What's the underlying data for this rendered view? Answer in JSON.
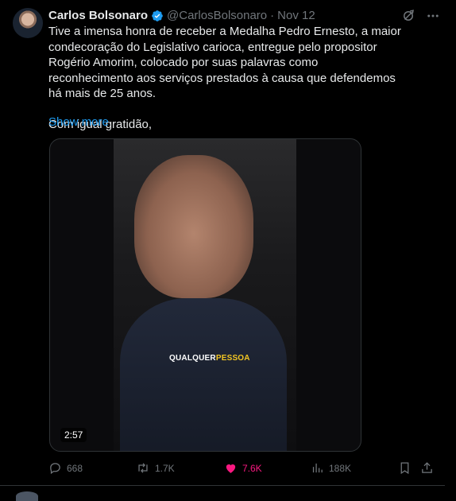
{
  "tweet": {
    "author_name": "Carlos Bolsonaro",
    "author_handle": "@CarlosBolsonaro",
    "separator": "·",
    "date": "Nov 12",
    "paragraphs": [
      "Tive a imensa honra de receber a Medalha Pedro Ernesto, a maior condecoração do Legislativo carioca, entregue pelo propositor Rogério Amorim, colocado por suas palavras como reconhecimento aos serviços prestados à causa que defendemos há mais de 25 anos.",
      "Com igual gratidão,"
    ],
    "show_more": "Show more",
    "video": {
      "caption_white": "QUALQUER",
      "caption_yellow": "PESSOA",
      "duration": "2:57"
    },
    "stats": {
      "replies": "668",
      "reposts": "1.7K",
      "likes": "7.6K",
      "views": "188K"
    }
  },
  "colors": {
    "background": "#000000",
    "text": "#e7e9ea",
    "muted": "#71767b",
    "link": "#1d9bf0",
    "like": "#f91880",
    "verified": "#1d9bf0",
    "caption_highlight": "#f3c623"
  },
  "icons": [
    "verified-badge-icon",
    "grok-icon",
    "more-icon",
    "reply-icon",
    "repost-icon",
    "like-icon",
    "views-icon",
    "bookmark-icon",
    "share-icon"
  ]
}
